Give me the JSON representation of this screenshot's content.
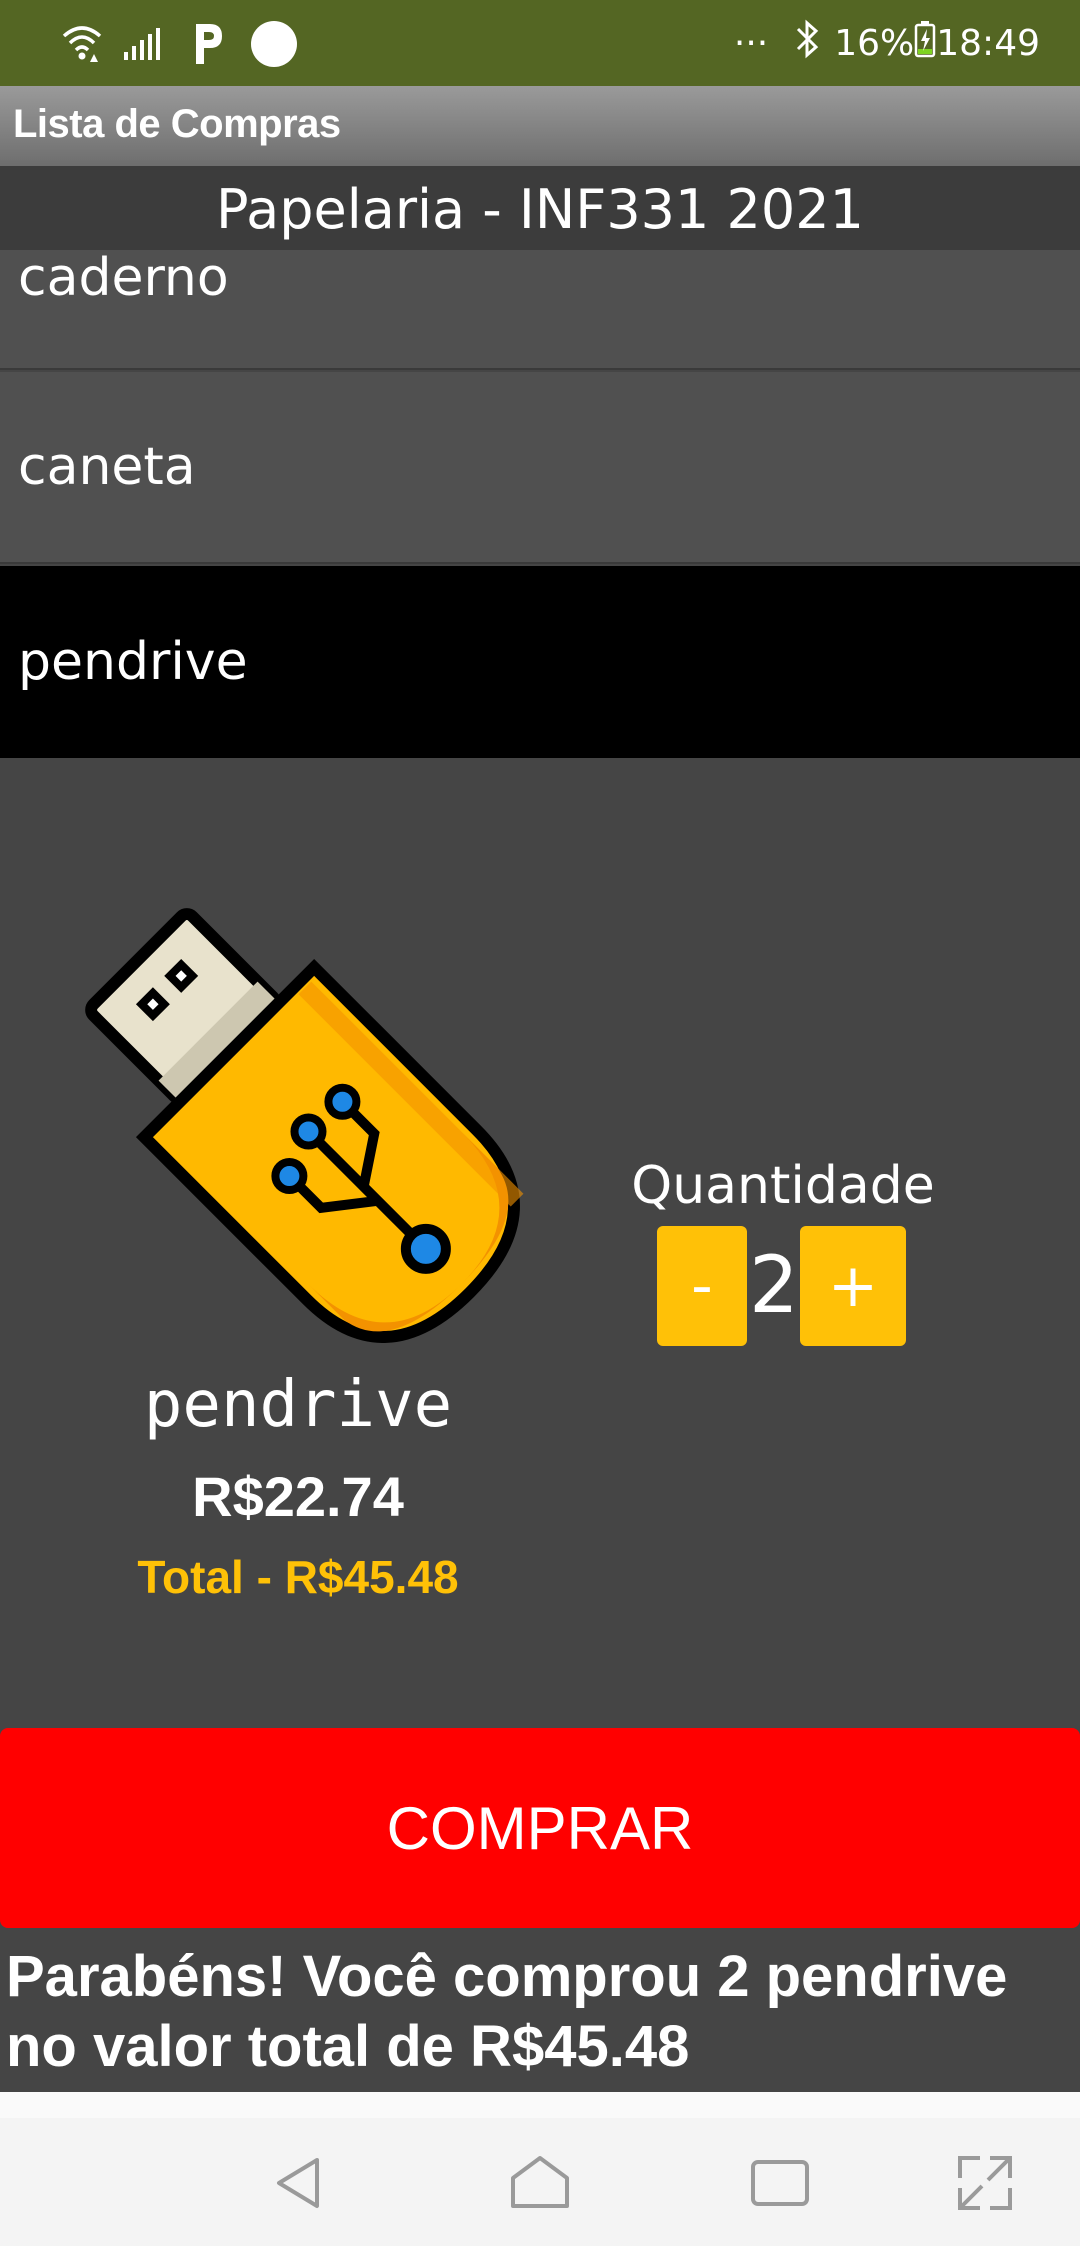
{
  "status_bar": {
    "dots": "···",
    "battery": "16%",
    "time": "18:49",
    "icons": [
      "wifi-icon",
      "signal-icon",
      "p-notification-icon",
      "circle-notification-icon",
      "bluetooth-icon",
      "battery-charging-icon"
    ]
  },
  "app_bar": {
    "title": "Lista de Compras"
  },
  "store": {
    "title": "Papelaria - INF331 2021"
  },
  "list": {
    "items": [
      {
        "label": "caderno"
      },
      {
        "label": "caneta"
      },
      {
        "label": "pendrive",
        "selected": true
      }
    ]
  },
  "product": {
    "name": "pendrive",
    "price": "R$22.74",
    "total": "Total - R$45.48",
    "image_icon": "usb-pendrive-icon"
  },
  "quantity": {
    "label": "Quantidade",
    "minus": "-",
    "value": "2",
    "plus": "+"
  },
  "buy_button": {
    "label": "COMPRAR"
  },
  "confirmation": {
    "text": "Parabéns! Você comprou 2 pendrive no valor total de R$45.48"
  },
  "nav_bar": {
    "icons": [
      "back-icon",
      "home-icon",
      "recents-icon",
      "expand-icon"
    ]
  },
  "colors": {
    "status_bar": "#546623",
    "accent": "#FFC107",
    "buy_button": "#FF0000",
    "background": "#454545",
    "selected_item": "#000000"
  }
}
